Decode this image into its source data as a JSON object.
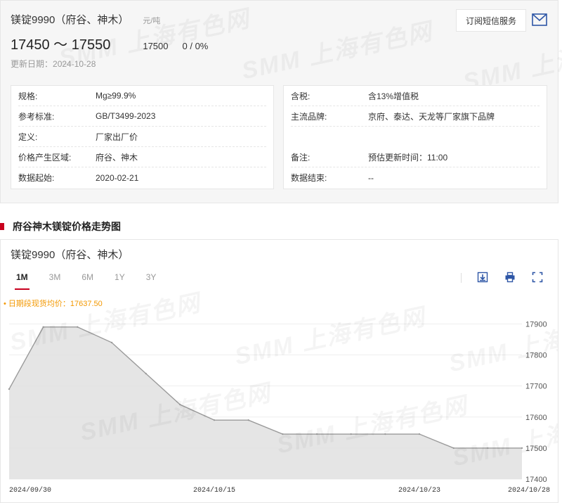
{
  "product": {
    "title": "镁锭9990（府谷、神木）",
    "unit": "元/吨",
    "price_range": "17450 ～ 17550",
    "avg_price": "17500",
    "change": "0 / 0%",
    "update_label": "更新日期：",
    "update_date": "2024-10-28"
  },
  "subscribe": {
    "label": "订阅短信服务",
    "mail_icon": "mail-icon"
  },
  "spec_left": [
    {
      "k": "规格:",
      "v": "Mg≥99.9%"
    },
    {
      "k": "参考标准:",
      "v": "GB/T3499-2023"
    },
    {
      "k": "定义:",
      "v": "厂家出厂价"
    },
    {
      "k": "价格产生区域:",
      "v": "府谷、神木"
    },
    {
      "k": "数据起始:",
      "v": "2020-02-21"
    }
  ],
  "spec_right": [
    {
      "k": "含税:",
      "v": "含13%增值税"
    },
    {
      "k": "主流品牌:",
      "v": "京府、泰达、天龙等厂家旗下品牌"
    },
    {
      "k": "备注:",
      "v": "预估更新时间：11:00"
    },
    {
      "k": "数据结束:",
      "v": "--"
    }
  ],
  "watermark": "SMM 上海有色网",
  "section_heading": "府谷神木镁锭价格走势图",
  "chart_panel": {
    "title": "镁锭9990（府谷、神木）",
    "tabs": [
      "1M",
      "3M",
      "6M",
      "1Y",
      "3Y"
    ],
    "active_tab": "1M",
    "tools": [
      "download-icon",
      "print-icon",
      "fullscreen-icon"
    ],
    "avg_note": "• 日期段现货均价：17637.50"
  },
  "chart_data": {
    "type": "area",
    "x": [
      "2024-09-30",
      "2024-10-08",
      "2024-10-09",
      "2024-10-10",
      "2024-10-11",
      "2024-10-14",
      "2024-10-15",
      "2024-10-16",
      "2024-10-17",
      "2024-10-18",
      "2024-10-21",
      "2024-10-22",
      "2024-10-23",
      "2024-10-24",
      "2024-10-25",
      "2024-10-28"
    ],
    "y": [
      17690,
      17890,
      17890,
      17840,
      17740,
      17640,
      17590,
      17590,
      17545,
      17545,
      17545,
      17545,
      17545,
      17500,
      17500,
      17500
    ],
    "x_tick_labels": [
      "2024/09/30",
      "2024/10/15",
      "2024/10/23",
      "2024/10/28"
    ],
    "x_tick_index": [
      0,
      6,
      12,
      15
    ],
    "y_ticks": [
      17400,
      17500,
      17600,
      17700,
      17800,
      17900
    ],
    "ylim": [
      17400,
      17935
    ],
    "y_axis_position": "right",
    "grid": true,
    "line_color": "#9a9a9a",
    "fill_color": "#e0e0e0"
  },
  "colors": {
    "accent": "#c8001e",
    "note": "#f39800"
  }
}
